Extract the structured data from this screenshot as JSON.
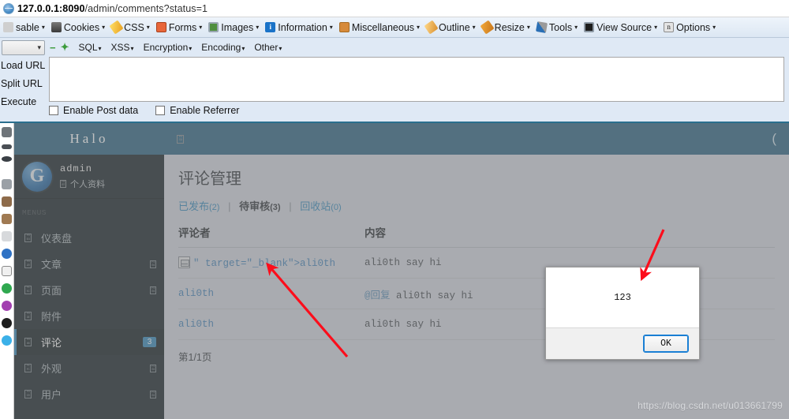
{
  "browser": {
    "url_host": "127.0.0.1:8090",
    "url_path": "/admin/comments?status=1",
    "favicon": "page-favicon"
  },
  "webdev_toolbar": {
    "items": [
      {
        "label": "sable",
        "icon": "disable-icon",
        "caret": "▾"
      },
      {
        "label": "Cookies",
        "icon": "cookies-icon",
        "caret": "▾"
      },
      {
        "label": "CSS",
        "icon": "css-icon",
        "caret": "▾"
      },
      {
        "label": "Forms",
        "icon": "forms-icon",
        "caret": "▾"
      },
      {
        "label": "Images",
        "icon": "images-icon",
        "caret": "▾"
      },
      {
        "label": "Information",
        "icon": "information-icon",
        "caret": "▾"
      },
      {
        "label": "Miscellaneous",
        "icon": "miscellaneous-icon",
        "caret": "▾"
      },
      {
        "label": "Outline",
        "icon": "outline-icon",
        "caret": "▾"
      },
      {
        "label": "Resize",
        "icon": "resize-icon",
        "caret": "▾"
      },
      {
        "label": "Tools",
        "icon": "tools-icon",
        "caret": "▾"
      },
      {
        "label": "View Source",
        "icon": "view-source-icon",
        "caret": "▾"
      },
      {
        "label": "Options",
        "icon": "options-icon",
        "caret": "▾"
      }
    ]
  },
  "hackbar": {
    "select_value": "",
    "minus_label": "−",
    "plus_label": "✦",
    "menus": [
      {
        "label": "SQL",
        "caret": "▾"
      },
      {
        "label": "XSS",
        "caret": "▾"
      },
      {
        "label": "Encryption",
        "caret": "▾"
      },
      {
        "label": "Encoding",
        "caret": "▾"
      },
      {
        "label": "Other",
        "caret": "▾"
      }
    ],
    "actions": [
      "Load URL",
      "Split URL",
      "Execute"
    ],
    "textarea_value": "",
    "checkbox_post": "Enable Post data",
    "checkbox_referrer": "Enable Referrer"
  },
  "sidebar": {
    "logo": "Halo",
    "user": {
      "name": "admin",
      "profile_label": "个人资料",
      "avatar_letter": "G"
    },
    "menus_label": "MENUS",
    "items": [
      {
        "label": "仪表盘",
        "icon": "dashboard-icon",
        "badge": "",
        "arrow": false,
        "active": false
      },
      {
        "label": "文章",
        "icon": "post-icon",
        "badge": "",
        "arrow": true,
        "active": false
      },
      {
        "label": "页面",
        "icon": "page-icon",
        "badge": "",
        "arrow": true,
        "active": false
      },
      {
        "label": "附件",
        "icon": "attachment-icon",
        "badge": "",
        "arrow": false,
        "active": false
      },
      {
        "label": "评论",
        "icon": "comment-icon",
        "badge": "3",
        "arrow": false,
        "active": true
      },
      {
        "label": "外观",
        "icon": "appearance-icon",
        "badge": "",
        "arrow": true,
        "active": false
      },
      {
        "label": "用户",
        "icon": "user-icon",
        "badge": "",
        "arrow": true,
        "active": false
      }
    ]
  },
  "navbar": {
    "toggle_icon": "sidebar-toggle-icon",
    "right_icon": "("
  },
  "main": {
    "page_title": "评论管理",
    "tabs": [
      {
        "label": "已发布",
        "count": "(2)"
      },
      {
        "label": "待审核",
        "count": "(3)"
      },
      {
        "label": "回收站",
        "count": "(0)"
      }
    ],
    "tab_separator": "|",
    "table": {
      "headers": [
        "评论者",
        "内容"
      ],
      "rows": [
        {
          "author": "\" target=\"_blank\">ali0th",
          "author_has_broken_image": true,
          "content_mention": "",
          "content": "ali0th say hi"
        },
        {
          "author": "ali0th",
          "author_has_broken_image": false,
          "content_mention": "@回复",
          "content": "ali0th say hi"
        },
        {
          "author": "ali0th",
          "author_has_broken_image": false,
          "content_mention": "",
          "content": "ali0th say hi"
        }
      ]
    },
    "pager": "第1/1页"
  },
  "alert_dialog": {
    "message": "123",
    "ok_label": "OK"
  },
  "annotations": {
    "arrow_color": "#fc0d1b",
    "arrow_count": 2
  },
  "watermark": "https://blog.csdn.net/u013661799",
  "colors": {
    "navbar": "#356b87",
    "sidebar": "#222d32",
    "accent": "#3c8dbc",
    "link": "#4a86b8",
    "arrow": "#fc0d1b"
  }
}
